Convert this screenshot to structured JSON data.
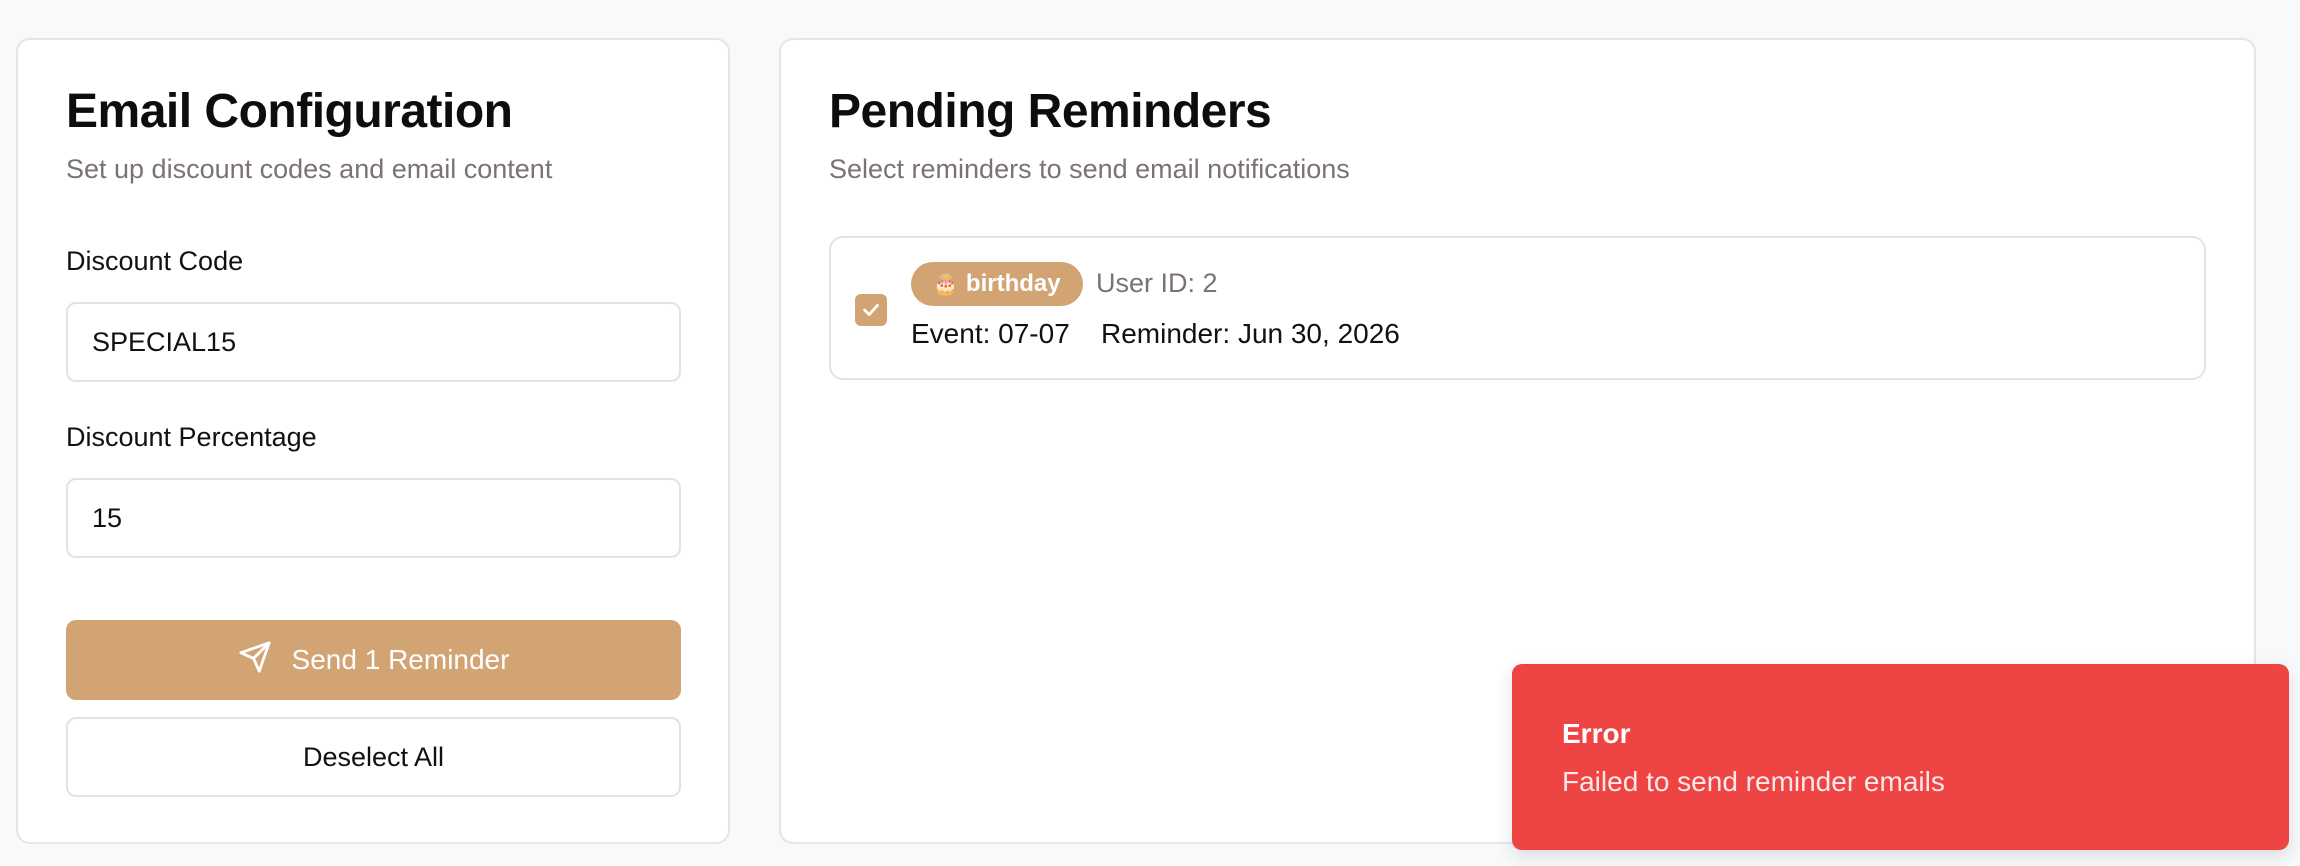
{
  "email_config": {
    "title": "Email Configuration",
    "subtitle": "Set up discount codes and email content",
    "discount_code_label": "Discount Code",
    "discount_code_value": "SPECIAL15",
    "discount_percentage_label": "Discount Percentage",
    "discount_percentage_value": "15",
    "send_button_label": "Send 1 Reminder",
    "send_icon": "send-icon",
    "deselect_button_label": "Deselect All"
  },
  "pending": {
    "title": "Pending Reminders",
    "subtitle": "Select reminders to send email notifications",
    "items": [
      {
        "checked": true,
        "badge_icon": "🎂",
        "badge_label": "birthday",
        "user_id": "User ID: 2",
        "event": "Event: 07-07",
        "reminder": "Reminder: Jun 30, 2026"
      }
    ]
  },
  "toast": {
    "title": "Error",
    "message": "Failed to send reminder emails"
  },
  "colors": {
    "accent": "#d3a473",
    "error": "#ef4444",
    "background": "#f8f9fb",
    "muted_text": "#7a7371"
  }
}
